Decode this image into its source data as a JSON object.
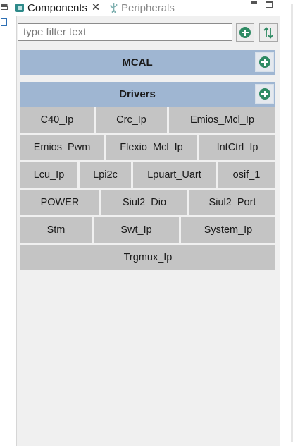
{
  "tabs": {
    "active": {
      "label": "Components",
      "close_glyph": "🗙"
    },
    "inactive": {
      "label": "Peripherals"
    }
  },
  "filter": {
    "value": "",
    "placeholder": "type filter text"
  },
  "sections": {
    "mcal": {
      "title": "MCAL"
    },
    "drivers": {
      "title": "Drivers"
    }
  },
  "drivers": {
    "rows": [
      [
        "C40_Ip",
        "Crc_Ip",
        "Emios_Mcl_Ip"
      ],
      [
        "Emios_Pwm",
        "Flexio_Mcl_Ip",
        "IntCtrl_Ip"
      ],
      [
        "Lcu_Ip",
        "Lpi2c",
        "Lpuart_Uart",
        "osif_1"
      ],
      [
        "POWER",
        "Siul2_Dio",
        "Siul2_Port"
      ],
      [
        "Stm",
        "Swt_Ip",
        "System_Ip"
      ],
      [
        "Trgmux_Ip"
      ]
    ]
  },
  "colors": {
    "section_header": "#9fb6d2",
    "component_button": "#c4c4c4",
    "add_icon": "#2e8a63",
    "panel_bg": "#f0f0f0"
  },
  "icons": {
    "components_tab": "components-icon",
    "peripherals_tab": "usb-icon",
    "add": "add-circle-icon",
    "sort": "sort-icon",
    "minimize": "minimize-icon",
    "maximize": "maximize-icon"
  }
}
